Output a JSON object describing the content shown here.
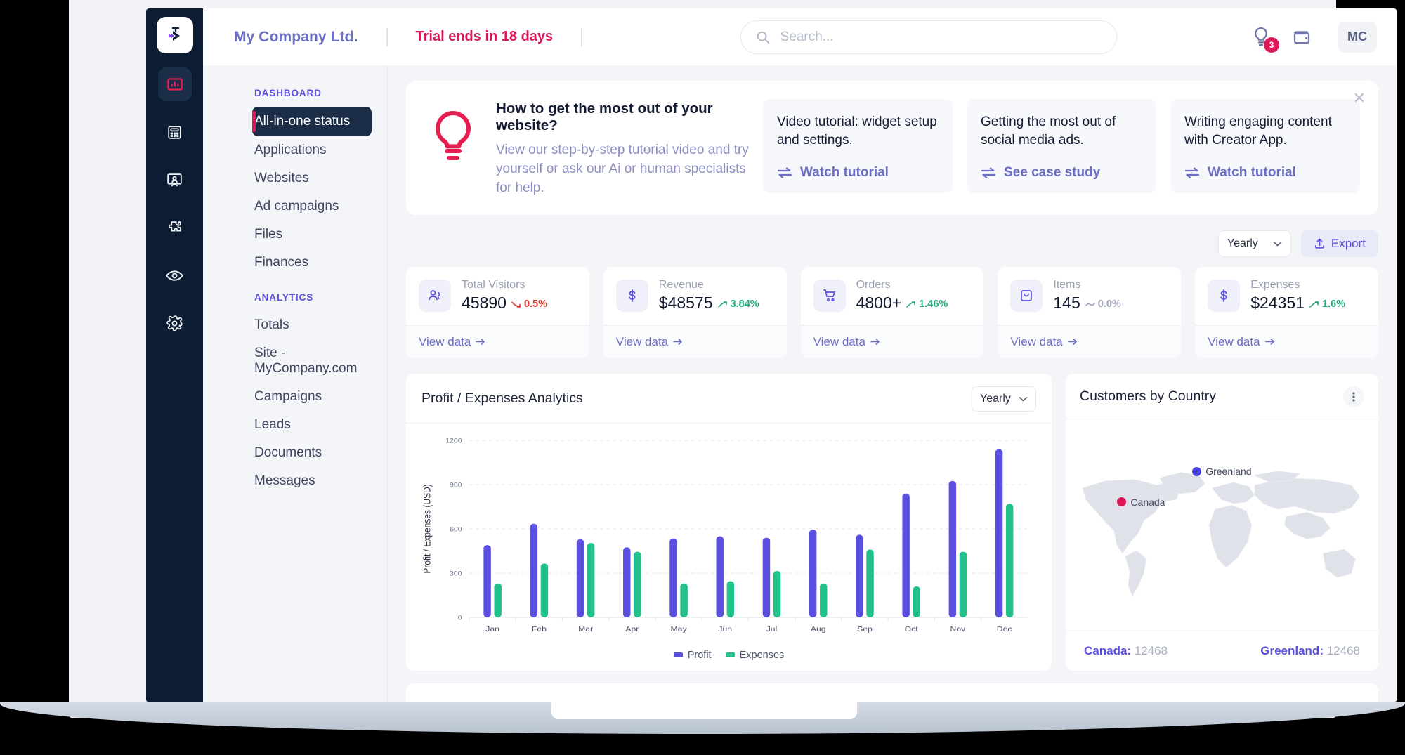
{
  "brand": {
    "logo_icon": "chevron-logo-icon"
  },
  "topbar": {
    "company": "My Company Ltd.",
    "trial_notice": "Trial ends in 18 days",
    "search_placeholder": "Search...",
    "search_value": "",
    "search_icon": "search-icon",
    "bulb_icon": "lightbulb-icon",
    "bulb_badge": "3",
    "wallet_icon": "wallet-icon",
    "avatar_initials": "MC"
  },
  "rail": {
    "items": [
      {
        "icon": "bar-chart-icon",
        "active": true
      },
      {
        "icon": "calculator-icon",
        "active": false
      },
      {
        "icon": "presentation-user-icon",
        "active": false
      },
      {
        "icon": "puzzle-piece-icon",
        "active": false
      },
      {
        "icon": "eye-icon",
        "active": false
      },
      {
        "icon": "gear-icon",
        "active": false
      }
    ]
  },
  "sidebar": {
    "groups": [
      {
        "title": "DASHBOARD",
        "items": [
          {
            "label": "All-in-one status",
            "active": true
          },
          {
            "label": "Applications",
            "active": false
          },
          {
            "label": "Websites",
            "active": false
          },
          {
            "label": "Ad campaigns",
            "active": false
          },
          {
            "label": "Files",
            "active": false
          },
          {
            "label": "Finances",
            "active": false
          }
        ]
      },
      {
        "title": "ANALYTICS",
        "items": [
          {
            "label": "Totals",
            "active": false
          },
          {
            "label": "Site - MyCompany.com",
            "active": false
          },
          {
            "label": "Campaigns",
            "active": false
          },
          {
            "label": "Leads",
            "active": false
          },
          {
            "label": "Documents",
            "active": false
          },
          {
            "label": "Messages",
            "active": false
          }
        ]
      }
    ]
  },
  "promo": {
    "icon": "lightbulb-icon",
    "title": "How to get the most out of your website?",
    "subtitle": "View our step-by-step tutorial video and try yourself or ask our Ai or human specialists for help.",
    "close_icon": "close-icon",
    "cards": [
      {
        "text": "Video tutorial: widget setup and settings.",
        "link": "Watch tutorial",
        "link_icon": "arrows-exchange-icon"
      },
      {
        "text": "Getting the most out of social media ads.",
        "link": "See case study",
        "link_icon": "arrows-exchange-icon"
      },
      {
        "text": "Writing engaging content with Creator App.",
        "link": "Watch tutorial",
        "link_icon": "arrows-exchange-icon"
      }
    ]
  },
  "toolbar": {
    "period": "Yearly",
    "chevron_icon": "chevron-down-icon",
    "export_label": "Export",
    "export_icon": "upload-icon"
  },
  "kpis": [
    {
      "icon": "users-icon",
      "label": "Total Visitors",
      "value": "45890",
      "delta": "0.5%",
      "trend": "down",
      "footer": "View data",
      "footer_icon": "arrow-right-icon"
    },
    {
      "icon": "dollar-icon",
      "label": "Revenue",
      "value": "$48575",
      "delta": "3.84%",
      "trend": "up",
      "footer": "View data",
      "footer_icon": "arrow-right-icon"
    },
    {
      "icon": "cart-icon",
      "label": "Orders",
      "value": "4800+",
      "delta": "1.46%",
      "trend": "up",
      "footer": "View data",
      "footer_icon": "arrow-right-icon"
    },
    {
      "icon": "bag-icon",
      "label": "Items",
      "value": "145",
      "delta": "0.0%",
      "trend": "flat",
      "footer": "View data",
      "footer_icon": "arrow-right-icon"
    },
    {
      "icon": "dollar-icon",
      "label": "Expenses",
      "value": "$24351",
      "delta": "1.6%",
      "trend": "up",
      "footer": "View data",
      "footer_icon": "arrow-right-icon"
    }
  ],
  "chart_panel": {
    "title": "Profit / Expenses Analytics",
    "period": "Yearly",
    "chevron_icon": "chevron-down-icon"
  },
  "chart_data": {
    "type": "bar",
    "title": "Profit / Expenses Analytics",
    "xlabel": "",
    "ylabel": "Profit / Expenses (USD)",
    "categories": [
      "Jan",
      "Feb",
      "Mar",
      "Apr",
      "May",
      "Jun",
      "Jul",
      "Aug",
      "Sep",
      "Oct",
      "Nov",
      "Dec"
    ],
    "series": [
      {
        "name": "Profit",
        "color": "#5b4fe0",
        "values": [
          490,
          635,
          530,
          475,
          535,
          550,
          540,
          595,
          560,
          840,
          925,
          1140
        ]
      },
      {
        "name": "Expenses",
        "color": "#22c08a",
        "values": [
          230,
          365,
          505,
          445,
          230,
          245,
          315,
          230,
          460,
          210,
          445,
          770
        ]
      }
    ],
    "ylim": [
      0,
      1200
    ],
    "yticks": [
      0,
      300,
      600,
      900,
      1200
    ],
    "grid": true,
    "legend_position": "bottom"
  },
  "map_panel": {
    "title": "Customers by Country",
    "menu_icon": "dots-vertical-icon",
    "markers": [
      {
        "label": "Greenland",
        "color": "#4a3fd6",
        "x": 40.5,
        "y": 22.0
      },
      {
        "label": "Canada",
        "color": "#dd1858",
        "x": 16.5,
        "y": 36.5
      }
    ],
    "footer": [
      {
        "name": "Canada:",
        "count": "12468"
      },
      {
        "name": "Greenland:",
        "count": "12468"
      }
    ]
  },
  "colors": {
    "accent_purple": "#5b4fe0",
    "accent_pink": "#dd1858",
    "green": "#22c08a",
    "sidebar_dark": "#0b1c33"
  }
}
